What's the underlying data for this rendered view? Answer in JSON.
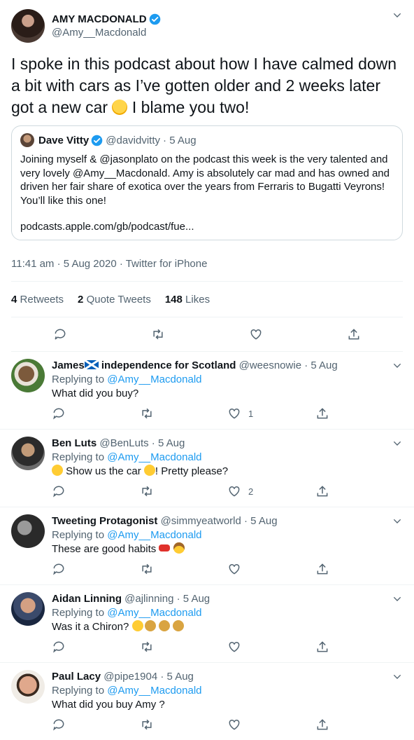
{
  "main_tweet": {
    "name": "AMY MACDONALD",
    "handle": "@Amy__Macdonald",
    "text_part1": "I spoke in this podcast about how I have calmed down a bit with cars as I’ve gotten older and 2 weeks later got a new car",
    "text_part2": " I blame you two!",
    "quote": {
      "name": "Dave Vitty",
      "handle": "@davidvitty",
      "date": "· 5 Aug",
      "text": "Joining myself & @jasonplato on the podcast this week is the very talented and very lovely @Amy__Macdonald. Amy is absolutely car mad and has owned and driven her fair share of exotica over the years from Ferraris to Bugatti Veyrons! You’ll like this one!",
      "link": "podcasts.apple.com/gb/podcast/fue..."
    },
    "meta": "11:41 am · 5 Aug 2020 · Twitter for iPhone",
    "stats": {
      "retweets_count": "4",
      "retweets_label": "Retweets",
      "quotes_count": "2",
      "quotes_label": "Quote Tweets",
      "likes_count": "148",
      "likes_label": "Likes"
    }
  },
  "replies": [
    {
      "name_a": "James",
      "name_b": " independence for Scotland",
      "handle": "@weesnowie",
      "date": "· 5 Aug",
      "replying_label": "Replying to",
      "replying_to": "@Amy__Macdonald",
      "text": "What did you buy?",
      "likes": "1"
    },
    {
      "name": "Ben Luts",
      "handle": "@BenLuts",
      "date": "· 5 Aug",
      "replying_label": "Replying to",
      "replying_to": "@Amy__Macdonald",
      "text_a": " Show us the car ",
      "text_b": "! Pretty please?",
      "likes": "2"
    },
    {
      "name": "Tweeting Protagonist",
      "handle": "@simmyeatworld",
      "date": "· 5 Aug",
      "replying_label": "Replying to",
      "replying_to": "@Amy__Macdonald",
      "text": "These are good habits ",
      "likes": ""
    },
    {
      "name": "Aidan Linning",
      "handle": "@ajlinning",
      "date": "· 5 Aug",
      "replying_label": "Replying to",
      "replying_to": "@Amy__Macdonald",
      "text": "Was it a Chiron? ",
      "likes": ""
    },
    {
      "name": "Paul Lacy",
      "handle": "@pipe1904",
      "date": "· 5 Aug",
      "replying_label": "Replying to",
      "replying_to": "@Amy__Macdonald",
      "text": "What did you buy Amy ?",
      "likes": ""
    }
  ]
}
